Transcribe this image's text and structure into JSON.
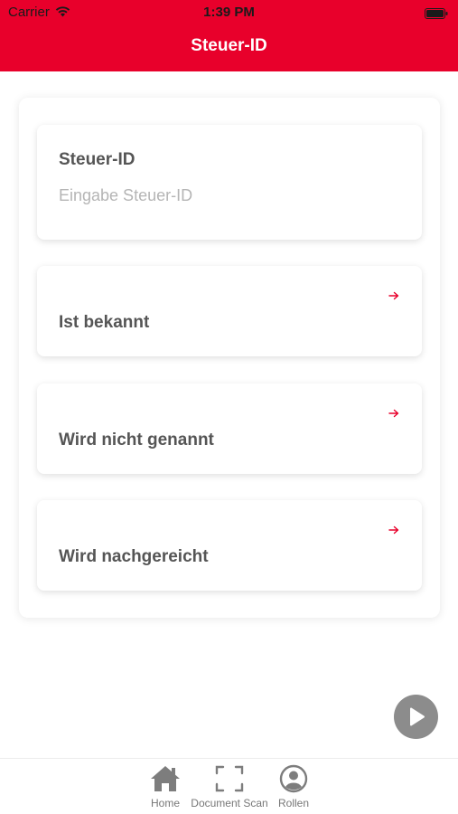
{
  "status_bar": {
    "carrier": "Carrier",
    "time": "1:39 PM"
  },
  "header": {
    "title": "Steuer-ID",
    "color": "#e8002b"
  },
  "steuer_id_field": {
    "label": "Steuer-ID",
    "placeholder": "Eingabe Steuer-ID",
    "value": ""
  },
  "options": [
    {
      "label": "Ist bekannt",
      "icon": "arrow-right-icon"
    },
    {
      "label": "Wird nicht genannt",
      "icon": "arrow-right-icon"
    },
    {
      "label": "Wird nachgereicht",
      "icon": "arrow-right-icon"
    }
  ],
  "play_button": {
    "icon": "play-icon"
  },
  "tab_bar": {
    "items": [
      {
        "label": "Home",
        "icon": "home-icon"
      },
      {
        "label": "Document Scan",
        "icon": "scan-icon"
      },
      {
        "label": "Rollen",
        "icon": "user-circle-icon"
      }
    ]
  },
  "colors": {
    "accent": "#e8002b",
    "text": "#555555",
    "placeholder": "#b5b5b5",
    "tab": "#777777"
  }
}
